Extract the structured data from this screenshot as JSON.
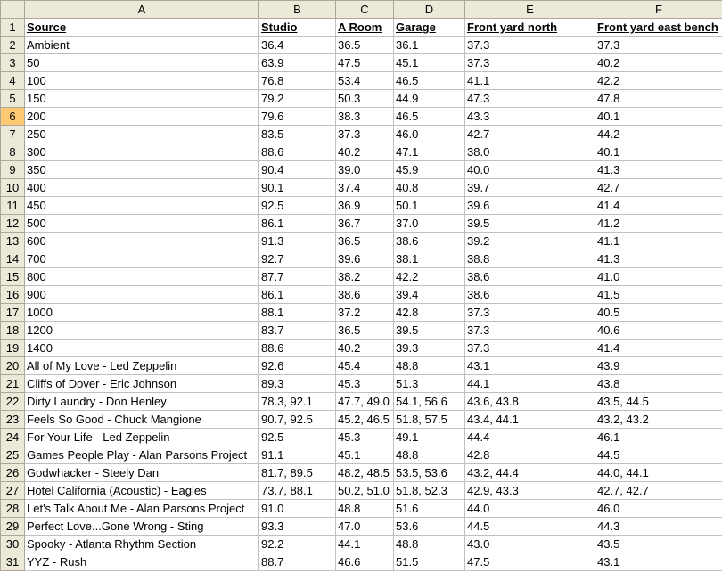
{
  "sheet": {
    "columns": [
      "A",
      "B",
      "C",
      "D",
      "E",
      "F"
    ],
    "selected_row": "6",
    "rows": [
      {
        "num": "1",
        "cells": [
          "Source",
          "Studio",
          "A Room",
          "Garage",
          "Front yard north",
          "Front yard east bench"
        ]
      },
      {
        "num": "2",
        "cells": [
          "Ambient",
          "36.4",
          "36.5",
          "36.1",
          "37.3",
          "37.3"
        ]
      },
      {
        "num": "3",
        "cells": [
          "50",
          "63.9",
          "47.5",
          "45.1",
          "37.3",
          "40.2"
        ]
      },
      {
        "num": "4",
        "cells": [
          "100",
          "76.8",
          "53.4",
          "46.5",
          "41.1",
          "42.2"
        ]
      },
      {
        "num": "5",
        "cells": [
          "150",
          "79.2",
          "50.3",
          "44.9",
          "47.3",
          "47.8"
        ]
      },
      {
        "num": "6",
        "cells": [
          "200",
          "79.6",
          "38.3",
          "46.5",
          "43.3",
          "40.1"
        ]
      },
      {
        "num": "7",
        "cells": [
          "250",
          "83.5",
          "37.3",
          "46.0",
          "42.7",
          "44.2"
        ]
      },
      {
        "num": "8",
        "cells": [
          "300",
          "88.6",
          "40.2",
          "47.1",
          "38.0",
          "40.1"
        ]
      },
      {
        "num": "9",
        "cells": [
          "350",
          "90.4",
          "39.0",
          "45.9",
          "40.0",
          "41.3"
        ]
      },
      {
        "num": "10",
        "cells": [
          "400",
          "90.1",
          "37.4",
          "40.8",
          "39.7",
          "42.7"
        ]
      },
      {
        "num": "11",
        "cells": [
          "450",
          "92.5",
          "36.9",
          "50.1",
          "39.6",
          "41.4"
        ]
      },
      {
        "num": "12",
        "cells": [
          "500",
          "86.1",
          "36.7",
          "37.0",
          "39.5",
          "41.2"
        ]
      },
      {
        "num": "13",
        "cells": [
          "600",
          "91.3",
          "36.5",
          "38.6",
          "39.2",
          "41.1"
        ]
      },
      {
        "num": "14",
        "cells": [
          "700",
          "92.7",
          "39.6",
          "38.1",
          "38.8",
          "41.3"
        ]
      },
      {
        "num": "15",
        "cells": [
          "800",
          "87.7",
          "38.2",
          "42.2",
          "38.6",
          "41.0"
        ]
      },
      {
        "num": "16",
        "cells": [
          "900",
          "86.1",
          "38.6",
          "39.4",
          "38.6",
          "41.5"
        ]
      },
      {
        "num": "17",
        "cells": [
          "1000",
          "88.1",
          "37.2",
          "42.8",
          "37.3",
          "40.5"
        ]
      },
      {
        "num": "18",
        "cells": [
          "1200",
          "83.7",
          "36.5",
          "39.5",
          "37.3",
          "40.6"
        ]
      },
      {
        "num": "19",
        "cells": [
          "1400",
          "88.6",
          "40.2",
          "39.3",
          "37.3",
          "41.4"
        ]
      },
      {
        "num": "20",
        "cells": [
          "All of My Love - Led Zeppelin",
          "92.6",
          "45.4",
          "48.8",
          "43.1",
          "43.9"
        ]
      },
      {
        "num": "21",
        "cells": [
          "Cliffs of Dover - Eric Johnson",
          "89.3",
          "45.3",
          "51.3",
          "44.1",
          "43.8"
        ]
      },
      {
        "num": "22",
        "cells": [
          "Dirty Laundry - Don Henley",
          "78.3, 92.1",
          "47.7, 49.0",
          "54.1, 56.6",
          "43.6, 43.8",
          "43.5, 44.5"
        ]
      },
      {
        "num": "23",
        "cells": [
          "Feels So Good - Chuck Mangione",
          "90.7, 92.5",
          "45.2, 46.5",
          "51.8, 57.5",
          "43.4, 44.1",
          "43.2, 43.2"
        ]
      },
      {
        "num": "24",
        "cells": [
          "For Your Life - Led Zeppelin",
          "92.5",
          "45.3",
          "49.1",
          "44.4",
          "46.1"
        ]
      },
      {
        "num": "25",
        "cells": [
          "Games People Play - Alan Parsons Project",
          "91.1",
          "45.1",
          "48.8",
          "42.8",
          "44.5"
        ]
      },
      {
        "num": "26",
        "cells": [
          "Godwhacker - Steely Dan",
          "81.7, 89.5",
          "48.2, 48.5",
          "53.5, 53.6",
          "43.2, 44.4",
          "44.0, 44.1"
        ]
      },
      {
        "num": "27",
        "cells": [
          "Hotel California (Acoustic) - Eagles",
          "73.7, 88.1",
          "50.2, 51.0",
          "51.8, 52.3",
          "42.9, 43.3",
          "42.7, 42.7"
        ]
      },
      {
        "num": "28",
        "cells": [
          "Let's Talk About Me - Alan Parsons Project",
          "91.0",
          "48.8",
          "51.6",
          "44.0",
          "46.0"
        ]
      },
      {
        "num": "29",
        "cells": [
          "Perfect Love...Gone Wrong - Sting",
          "93.3",
          "47.0",
          "53.6",
          "44.5",
          "44.3"
        ]
      },
      {
        "num": "30",
        "cells": [
          "Spooky - Atlanta Rhythm Section",
          "92.2",
          "44.1",
          "48.8",
          "43.0",
          "43.5"
        ]
      },
      {
        "num": "31",
        "cells": [
          "YYZ - Rush",
          "88.7",
          "46.6",
          "51.5",
          "47.5",
          "43.1"
        ]
      }
    ]
  }
}
